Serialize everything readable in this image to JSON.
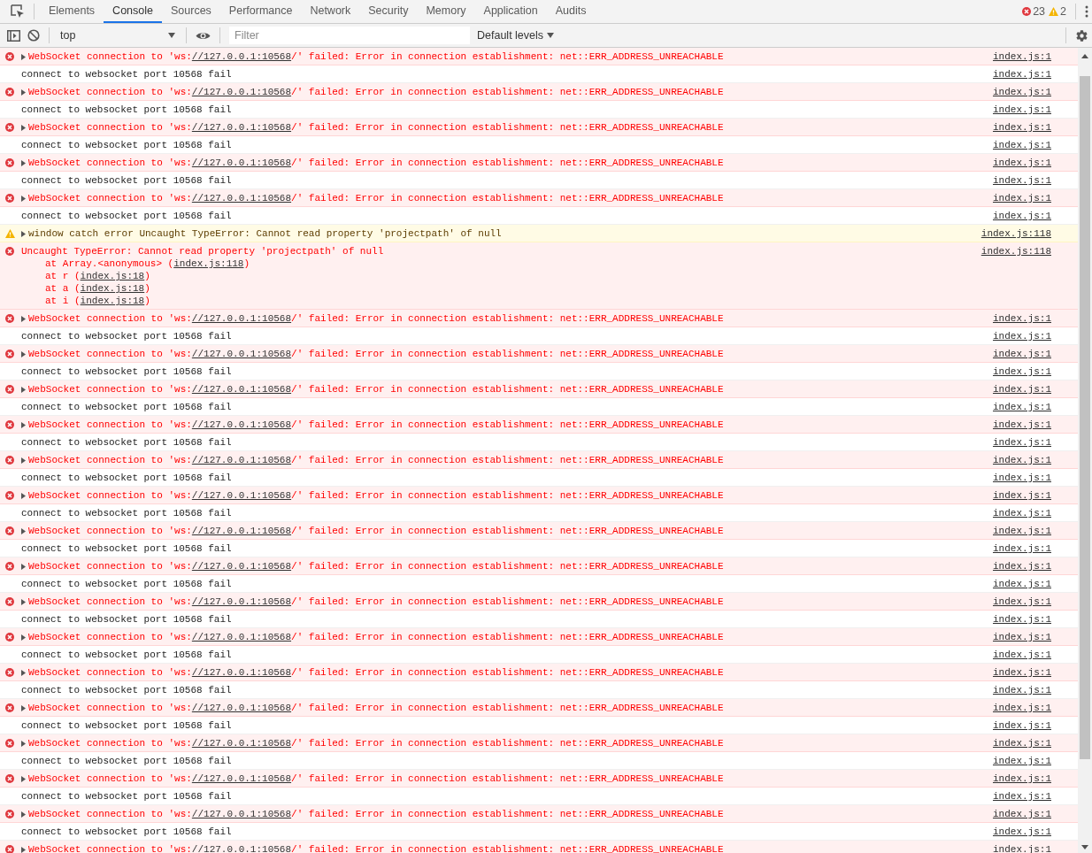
{
  "tabs": [
    {
      "label": "Elements",
      "selected": false
    },
    {
      "label": "Console",
      "selected": true
    },
    {
      "label": "Sources",
      "selected": false
    },
    {
      "label": "Performance",
      "selected": false
    },
    {
      "label": "Network",
      "selected": false
    },
    {
      "label": "Security",
      "selected": false
    },
    {
      "label": "Memory",
      "selected": false
    },
    {
      "label": "Application",
      "selected": false
    },
    {
      "label": "Audits",
      "selected": false
    }
  ],
  "counts": {
    "errors": "23",
    "warnings": "2"
  },
  "toolbar": {
    "context": "top",
    "filter_placeholder": "Filter",
    "levels": "Default levels"
  },
  "messages": [
    {
      "kind": "error",
      "prefix": "WebSocket connection to 'ws:",
      "url": "//127.0.0.1:10568",
      "suffix": "/' failed: Error in connection establishment: net::ERR_ADDRESS_UNREACHABLE",
      "source": "index.js:1"
    },
    {
      "kind": "log",
      "text": "connect to websocket port 10568 fail",
      "source": "index.js:1"
    },
    {
      "kind": "error",
      "prefix": "WebSocket connection to 'ws:",
      "url": "//127.0.0.1:10568",
      "suffix": "/' failed: Error in connection establishment: net::ERR_ADDRESS_UNREACHABLE",
      "source": "index.js:1"
    },
    {
      "kind": "log",
      "text": "connect to websocket port 10568 fail",
      "source": "index.js:1"
    },
    {
      "kind": "error",
      "prefix": "WebSocket connection to 'ws:",
      "url": "//127.0.0.1:10568",
      "suffix": "/' failed: Error in connection establishment: net::ERR_ADDRESS_UNREACHABLE",
      "source": "index.js:1"
    },
    {
      "kind": "log",
      "text": "connect to websocket port 10568 fail",
      "source": "index.js:1"
    },
    {
      "kind": "error",
      "prefix": "WebSocket connection to 'ws:",
      "url": "//127.0.0.1:10568",
      "suffix": "/' failed: Error in connection establishment: net::ERR_ADDRESS_UNREACHABLE",
      "source": "index.js:1"
    },
    {
      "kind": "log",
      "text": "connect to websocket port 10568 fail",
      "source": "index.js:1"
    },
    {
      "kind": "error",
      "prefix": "WebSocket connection to 'ws:",
      "url": "//127.0.0.1:10568",
      "suffix": "/' failed: Error in connection establishment: net::ERR_ADDRESS_UNREACHABLE",
      "source": "index.js:1"
    },
    {
      "kind": "log",
      "text": "connect to websocket port 10568 fail",
      "source": "index.js:1"
    },
    {
      "kind": "warning",
      "text": "window catch error Uncaught TypeError: Cannot read property 'projectpath' of null",
      "source": "index.js:118"
    },
    {
      "kind": "exception",
      "text": "Uncaught TypeError: Cannot read property 'projectpath' of null",
      "source": "index.js:118",
      "stack": [
        {
          "prefix": "at Array.<anonymous> (",
          "link": "index.js:118",
          "suffix": ")"
        },
        {
          "prefix": "at r (",
          "link": "index.js:18",
          "suffix": ")"
        },
        {
          "prefix": "at a (",
          "link": "index.js:18",
          "suffix": ")"
        },
        {
          "prefix": "at i (",
          "link": "index.js:18",
          "suffix": ")"
        }
      ]
    },
    {
      "kind": "error",
      "prefix": "WebSocket connection to 'ws:",
      "url": "//127.0.0.1:10568",
      "suffix": "/' failed: Error in connection establishment: net::ERR_ADDRESS_UNREACHABLE",
      "source": "index.js:1"
    },
    {
      "kind": "log",
      "text": "connect to websocket port 10568 fail",
      "source": "index.js:1"
    },
    {
      "kind": "error",
      "prefix": "WebSocket connection to 'ws:",
      "url": "//127.0.0.1:10568",
      "suffix": "/' failed: Error in connection establishment: net::ERR_ADDRESS_UNREACHABLE",
      "source": "index.js:1"
    },
    {
      "kind": "log",
      "text": "connect to websocket port 10568 fail",
      "source": "index.js:1"
    },
    {
      "kind": "error",
      "prefix": "WebSocket connection to 'ws:",
      "url": "//127.0.0.1:10568",
      "suffix": "/' failed: Error in connection establishment: net::ERR_ADDRESS_UNREACHABLE",
      "source": "index.js:1"
    },
    {
      "kind": "log",
      "text": "connect to websocket port 10568 fail",
      "source": "index.js:1"
    },
    {
      "kind": "error",
      "prefix": "WebSocket connection to 'ws:",
      "url": "//127.0.0.1:10568",
      "suffix": "/' failed: Error in connection establishment: net::ERR_ADDRESS_UNREACHABLE",
      "source": "index.js:1"
    },
    {
      "kind": "log",
      "text": "connect to websocket port 10568 fail",
      "source": "index.js:1"
    },
    {
      "kind": "error",
      "prefix": "WebSocket connection to 'ws:",
      "url": "//127.0.0.1:10568",
      "suffix": "/' failed: Error in connection establishment: net::ERR_ADDRESS_UNREACHABLE",
      "source": "index.js:1"
    },
    {
      "kind": "log",
      "text": "connect to websocket port 10568 fail",
      "source": "index.js:1"
    },
    {
      "kind": "error",
      "prefix": "WebSocket connection to 'ws:",
      "url": "//127.0.0.1:10568",
      "suffix": "/' failed: Error in connection establishment: net::ERR_ADDRESS_UNREACHABLE",
      "source": "index.js:1"
    },
    {
      "kind": "log",
      "text": "connect to websocket port 10568 fail",
      "source": "index.js:1"
    },
    {
      "kind": "error",
      "prefix": "WebSocket connection to 'ws:",
      "url": "//127.0.0.1:10568",
      "suffix": "/' failed: Error in connection establishment: net::ERR_ADDRESS_UNREACHABLE",
      "source": "index.js:1"
    },
    {
      "kind": "log",
      "text": "connect to websocket port 10568 fail",
      "source": "index.js:1"
    },
    {
      "kind": "error",
      "prefix": "WebSocket connection to 'ws:",
      "url": "//127.0.0.1:10568",
      "suffix": "/' failed: Error in connection establishment: net::ERR_ADDRESS_UNREACHABLE",
      "source": "index.js:1"
    },
    {
      "kind": "log",
      "text": "connect to websocket port 10568 fail",
      "source": "index.js:1"
    },
    {
      "kind": "error",
      "prefix": "WebSocket connection to 'ws:",
      "url": "//127.0.0.1:10568",
      "suffix": "/' failed: Error in connection establishment: net::ERR_ADDRESS_UNREACHABLE",
      "source": "index.js:1"
    },
    {
      "kind": "log",
      "text": "connect to websocket port 10568 fail",
      "source": "index.js:1"
    },
    {
      "kind": "error",
      "prefix": "WebSocket connection to 'ws:",
      "url": "//127.0.0.1:10568",
      "suffix": "/' failed: Error in connection establishment: net::ERR_ADDRESS_UNREACHABLE",
      "source": "index.js:1"
    },
    {
      "kind": "log",
      "text": "connect to websocket port 10568 fail",
      "source": "index.js:1"
    },
    {
      "kind": "error",
      "prefix": "WebSocket connection to 'ws:",
      "url": "//127.0.0.1:10568",
      "suffix": "/' failed: Error in connection establishment: net::ERR_ADDRESS_UNREACHABLE",
      "source": "index.js:1"
    },
    {
      "kind": "log",
      "text": "connect to websocket port 10568 fail",
      "source": "index.js:1"
    },
    {
      "kind": "error",
      "prefix": "WebSocket connection to 'ws:",
      "url": "//127.0.0.1:10568",
      "suffix": "/' failed: Error in connection establishment: net::ERR_ADDRESS_UNREACHABLE",
      "source": "index.js:1"
    },
    {
      "kind": "log",
      "text": "connect to websocket port 10568 fail",
      "source": "index.js:1"
    },
    {
      "kind": "error",
      "prefix": "WebSocket connection to 'ws:",
      "url": "//127.0.0.1:10568",
      "suffix": "/' failed: Error in connection establishment: net::ERR_ADDRESS_UNREACHABLE",
      "source": "index.js:1"
    },
    {
      "kind": "log",
      "text": "connect to websocket port 10568 fail",
      "source": "index.js:1"
    },
    {
      "kind": "error",
      "prefix": "WebSocket connection to 'ws:",
      "url": "//127.0.0.1:10568",
      "suffix": "/' failed: Error in connection establishment: net::ERR_ADDRESS_UNREACHABLE",
      "source": "index.js:1"
    },
    {
      "kind": "log",
      "text": "connect to websocket port 10568 fail",
      "source": "index.js:1"
    },
    {
      "kind": "error",
      "prefix": "WebSocket connection to 'ws:",
      "url": "//127.0.0.1:10568",
      "suffix": "/' failed: Error in connection establishment: net::ERR_ADDRESS_UNREACHABLE",
      "source": "index.js:1"
    },
    {
      "kind": "log",
      "text": "connect to websocket port 10568 fail",
      "source": "index.js:1"
    },
    {
      "kind": "error",
      "prefix": "WebSocket connection to 'ws:",
      "url": "//127.0.0.1:10568",
      "suffix": "/' failed: Error in connection establishment: net::ERR_ADDRESS_UNREACHABLE",
      "source": "index.js:1"
    }
  ]
}
